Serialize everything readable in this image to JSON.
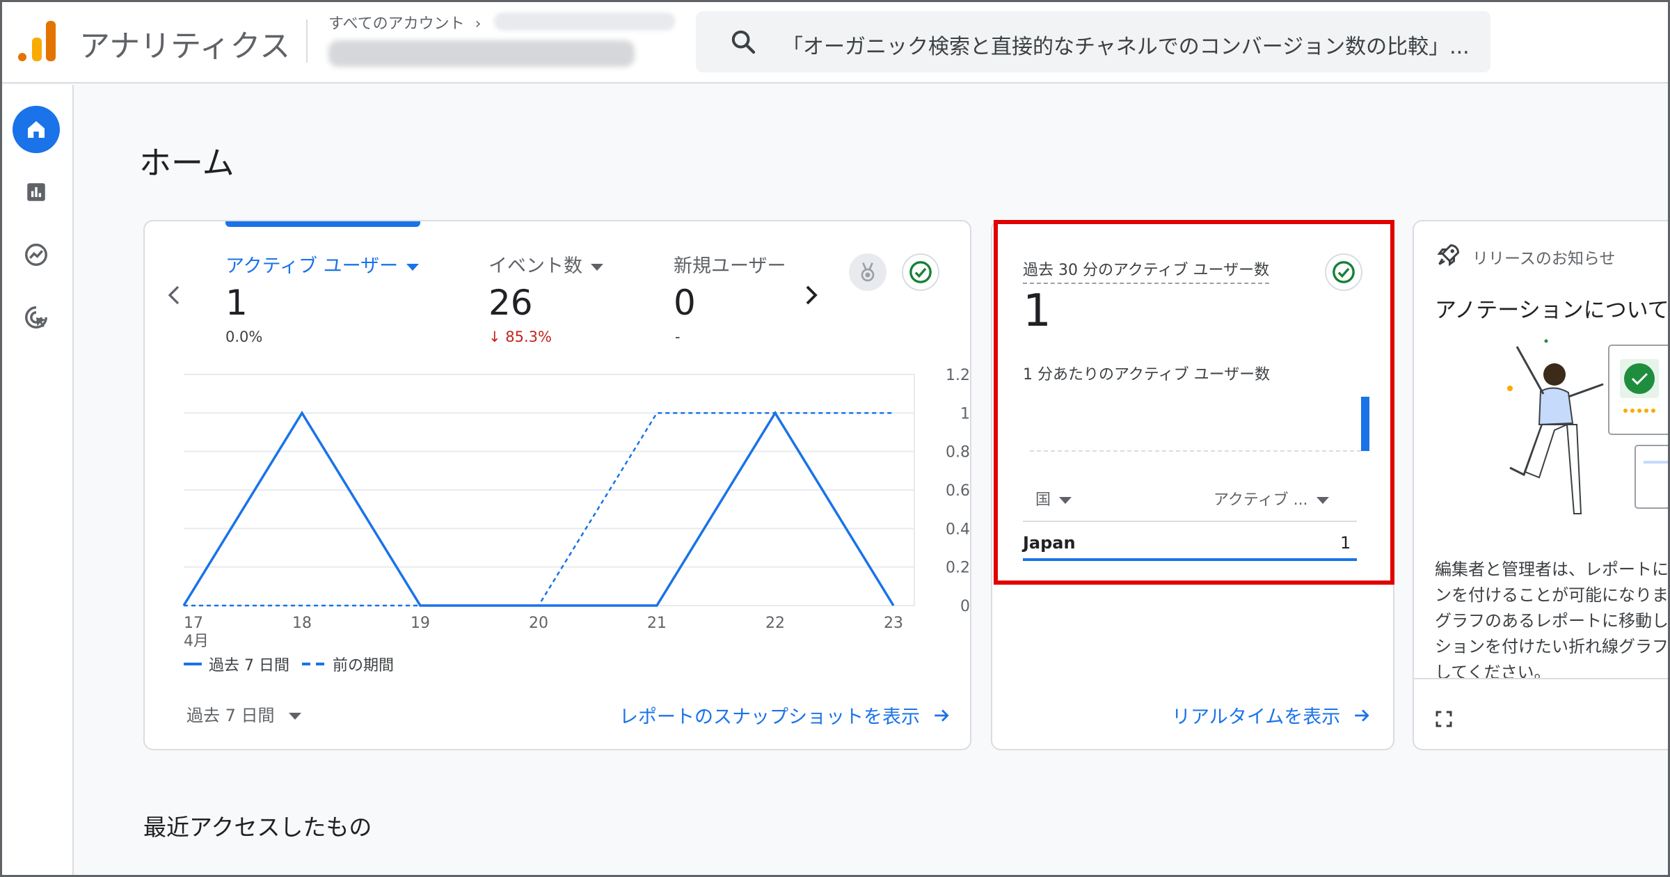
{
  "header": {
    "app_name": "アナリティクス",
    "breadcrumb": "すべてのアカウント",
    "search_text": "「オーガニック検索と直接的なチャネルでのコンバージョン数の比較」..."
  },
  "page": {
    "title": "ホーム",
    "recent_title": "最近アクセスしたもの"
  },
  "overview": {
    "metrics": [
      {
        "label": "アクティブ ユーザー",
        "value": "1",
        "sub": "0.0%"
      },
      {
        "label": "イベント数",
        "value": "26",
        "sub": "↓ 85.3%"
      },
      {
        "label": "新規ユーザー",
        "value": "0",
        "sub": "-"
      }
    ],
    "legend": {
      "current": "過去 7 日間",
      "previous": "前の期間"
    },
    "period_label": "過去 7 日間",
    "snapshot_link": "レポートのスナップショットを表示"
  },
  "chart_data": {
    "type": "line",
    "categories": [
      "17",
      "18",
      "19",
      "20",
      "21",
      "22",
      "23"
    ],
    "x_sublabel": "4月",
    "series": [
      {
        "name": "過去 7 日間",
        "values": [
          0,
          1,
          0,
          0,
          0,
          1,
          0
        ],
        "style": "solid"
      },
      {
        "name": "前の期間",
        "values": [
          0,
          0,
          0,
          0,
          1,
          1,
          1
        ],
        "style": "dashed"
      }
    ],
    "ylim": [
      0,
      1.2
    ],
    "yticks": [
      "0",
      "0.2",
      "0.4",
      "0.6",
      "0.8",
      "1",
      "1.2"
    ],
    "grid": true,
    "axis_side": "right",
    "color": "#1a73e8"
  },
  "realtime": {
    "title": "過去 30 分のアクティブ ユーザー数",
    "value": "1",
    "per_minute_label": "1 分あたりのアクティブ ユーザー数",
    "col_country": "国",
    "col_active": "アクティブ ...",
    "rows": [
      {
        "country": "Japan",
        "value": "1"
      }
    ],
    "link": "リアルタイムを表示"
  },
  "release": {
    "title": "リリースのお知らせ",
    "heading": "アノテーションについて",
    "body_lines": [
      "編集者と管理者は、レポートに",
      "ンを付けることが可能になりま",
      "グラフのあるレポートに移動し",
      "ションを付けたい折れ線グラフ",
      "してください。"
    ]
  },
  "colors": {
    "accent": "#1a73e8",
    "highlight": "#e00000",
    "negative": "#c5221f",
    "success": "#188038"
  }
}
